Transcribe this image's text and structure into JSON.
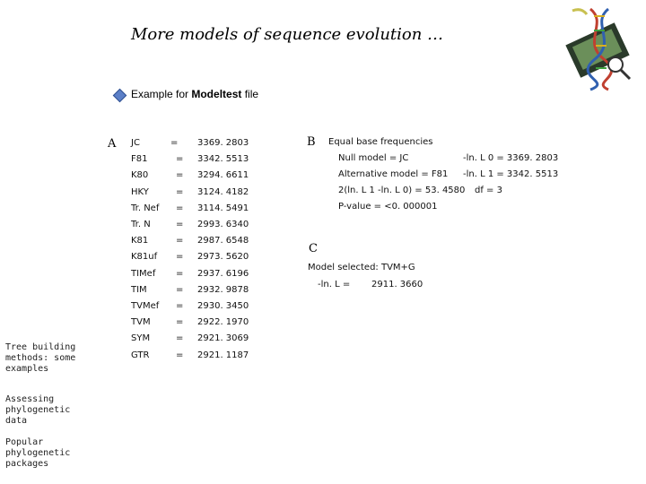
{
  "title": "More models of sequence evolution …",
  "intro": {
    "prefix": "Example for ",
    "bold": "Modeltest",
    "suffix": " file"
  },
  "section_a": {
    "letter": "A",
    "rows": [
      {
        "model": "JC",
        "eq": "=",
        "value": "3369. 2803"
      },
      {
        "model": "F81",
        "eq": "=",
        "value": "3342. 5513"
      },
      {
        "model": "K80",
        "eq": "=",
        "value": "3294. 6611"
      },
      {
        "model": "HKY",
        "eq": "=",
        "value": "3124. 4182"
      },
      {
        "model": "Tr. Nef",
        "eq": "=",
        "value": "3114. 5491"
      },
      {
        "model": "Tr. N",
        "eq": "=",
        "value": "2993. 6340"
      },
      {
        "model": "K81",
        "eq": "=",
        "value": "2987. 6548"
      },
      {
        "model": "K81uf",
        "eq": "=",
        "value": "2973. 5620"
      },
      {
        "model": "TIMef",
        "eq": "=",
        "value": "2937. 6196"
      },
      {
        "model": "TIM",
        "eq": "=",
        "value": "2932. 9878"
      },
      {
        "model": "TVMef",
        "eq": "=",
        "value": "2930. 3450"
      },
      {
        "model": "TVM",
        "eq": "=",
        "value": "2922. 1970"
      },
      {
        "model": "SYM",
        "eq": "=",
        "value": "2921. 3069"
      },
      {
        "model": "GTR",
        "eq": "=",
        "value": "2921. 1187"
      }
    ]
  },
  "section_b": {
    "letter": "B",
    "heading": "Equal base frequencies",
    "null_model": "Null model = JC",
    "null_lnl": "-ln. L 0 = 3369. 2803",
    "alt_model": "Alternative model = F81",
    "alt_lnl": "-ln. L 1 = 3342. 5513",
    "lrt": "2(ln. L 1 -ln. L 0) = 53. 4580",
    "df": "df = 3",
    "pvalue": "P-value = <0. 000001"
  },
  "section_c": {
    "letter": "C",
    "selected": "Model selected: TVM+G",
    "lnl_label": "-ln. L =",
    "lnl_value": "2911. 3660"
  },
  "sidebar": {
    "items": [
      "Tree building methods: some examples",
      "Assessing phylogenetic data",
      "Popular phylogenetic packages"
    ]
  },
  "logo_icon": "dna-helix-logo-icon"
}
